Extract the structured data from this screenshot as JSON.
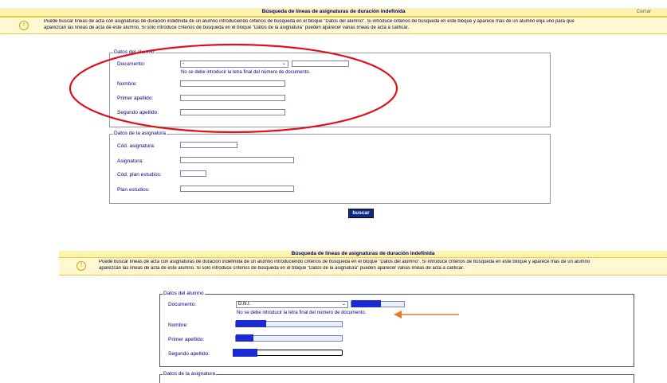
{
  "screen1": {
    "title": "Búsqueda de líneas de asignaturas de duración indefinida",
    "close_label": "Cerrar",
    "info_line1": "Puede buscar líneas de acta con asignaturas de duración indefinida de un alumno introduciendo criterios de búsqueda en el bloque \"Datos del alumno\". Si introduce criterios de búsqueda en este bloque y aparece más de un alumno elija uno para que",
    "info_line2": "aparezcan las líneas de acta de este alumno. Si sólo introduce criterios de búsqueda en el bloque \"Datos de la asignatura\" pueden aparecer varias líneas de acta a calificar.",
    "alumno": {
      "legend": "Datos del alumno",
      "documento_label": "Documento:",
      "documento_value": "-",
      "hint": "No se debe introducir la letra final del número de documento.",
      "nombre_label": "Nombre:",
      "apellido1_label": "Primer apellido:",
      "apellido2_label": "Segundo apellido:"
    },
    "asignatura": {
      "legend": "Datos de la asignatura",
      "cod_label": "Cód. asignatura:",
      "asig_label": "Asignatura:",
      "plan_cod_label": "Cód. plan estudios:",
      "plan_label": "Plan estudios:"
    },
    "search_button": "buscar"
  },
  "screen2": {
    "title": "Búsqueda de líneas de asignaturas de duración indefinida",
    "info_line1": "Puede buscar líneas de acta con asignaturas de duración indefinida de un alumno introduciendo criterios de búsqueda en el bloque \"Datos del alumno\". Si introduce criterios de búsqueda en este bloque y aparece más de un alumno",
    "info_line2": "aparezcan las líneas de acta de este alumno. Si sólo introduce criterios de búsqueda en el bloque \"Datos de la asignatura\" pueden aparecer varias líneas de acta a calificar.",
    "alumno": {
      "legend": "Datos del alumno",
      "documento_label": "Documento:",
      "documento_value": "D.N.I.",
      "hint": "No se debe introducir la letra final del número de documento.",
      "nombre_label": "Nombre:",
      "apellido1_label": "Primer apellido:",
      "apellido2_label": "Segundo apellido:"
    },
    "asignatura_legend": "Datos de la asignatura"
  },
  "colors": {
    "annotation_ellipse": "#e0101a",
    "annotation_arrow": "#e87a2a",
    "redaction": "#1a2bd6",
    "header_bg": "#fdf3b0"
  },
  "icons": [
    "info-icon",
    "chevron-down-icon"
  ]
}
